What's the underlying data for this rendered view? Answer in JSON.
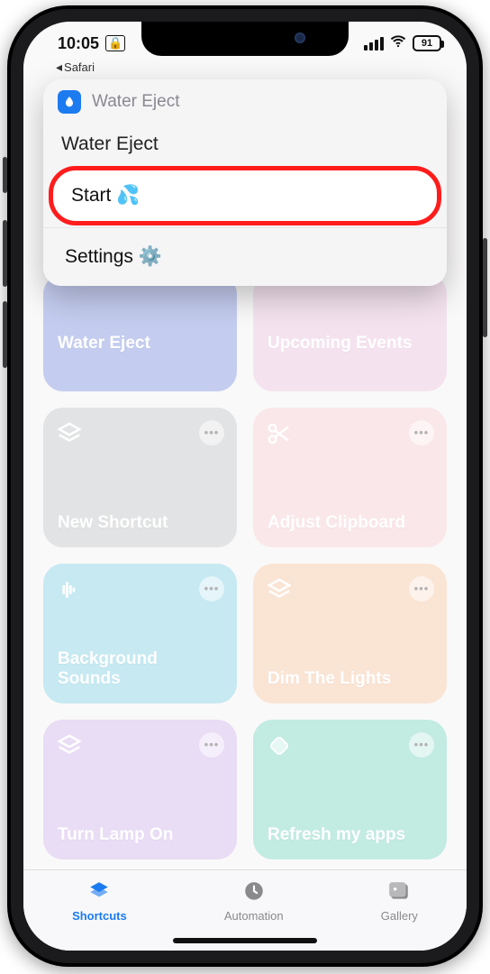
{
  "status": {
    "time": "10:05",
    "battery": "91"
  },
  "breadcrumb": {
    "label": "Safari"
  },
  "popup": {
    "appName": "Water Eject",
    "title": "Water Eject",
    "options": {
      "start": "Start 💦",
      "settings": "Settings ⚙️"
    }
  },
  "tiles": [
    {
      "label": "Water Eject"
    },
    {
      "label": "Upcoming Events"
    },
    {
      "label": "New Shortcut"
    },
    {
      "label": "Adjust Clipboard"
    },
    {
      "label": "Background Sounds"
    },
    {
      "label": "Dim The Lights"
    },
    {
      "label": "Turn Lamp On"
    },
    {
      "label": "Refresh my apps"
    }
  ],
  "tabs": {
    "shortcuts": "Shortcuts",
    "automation": "Automation",
    "gallery": "Gallery"
  }
}
